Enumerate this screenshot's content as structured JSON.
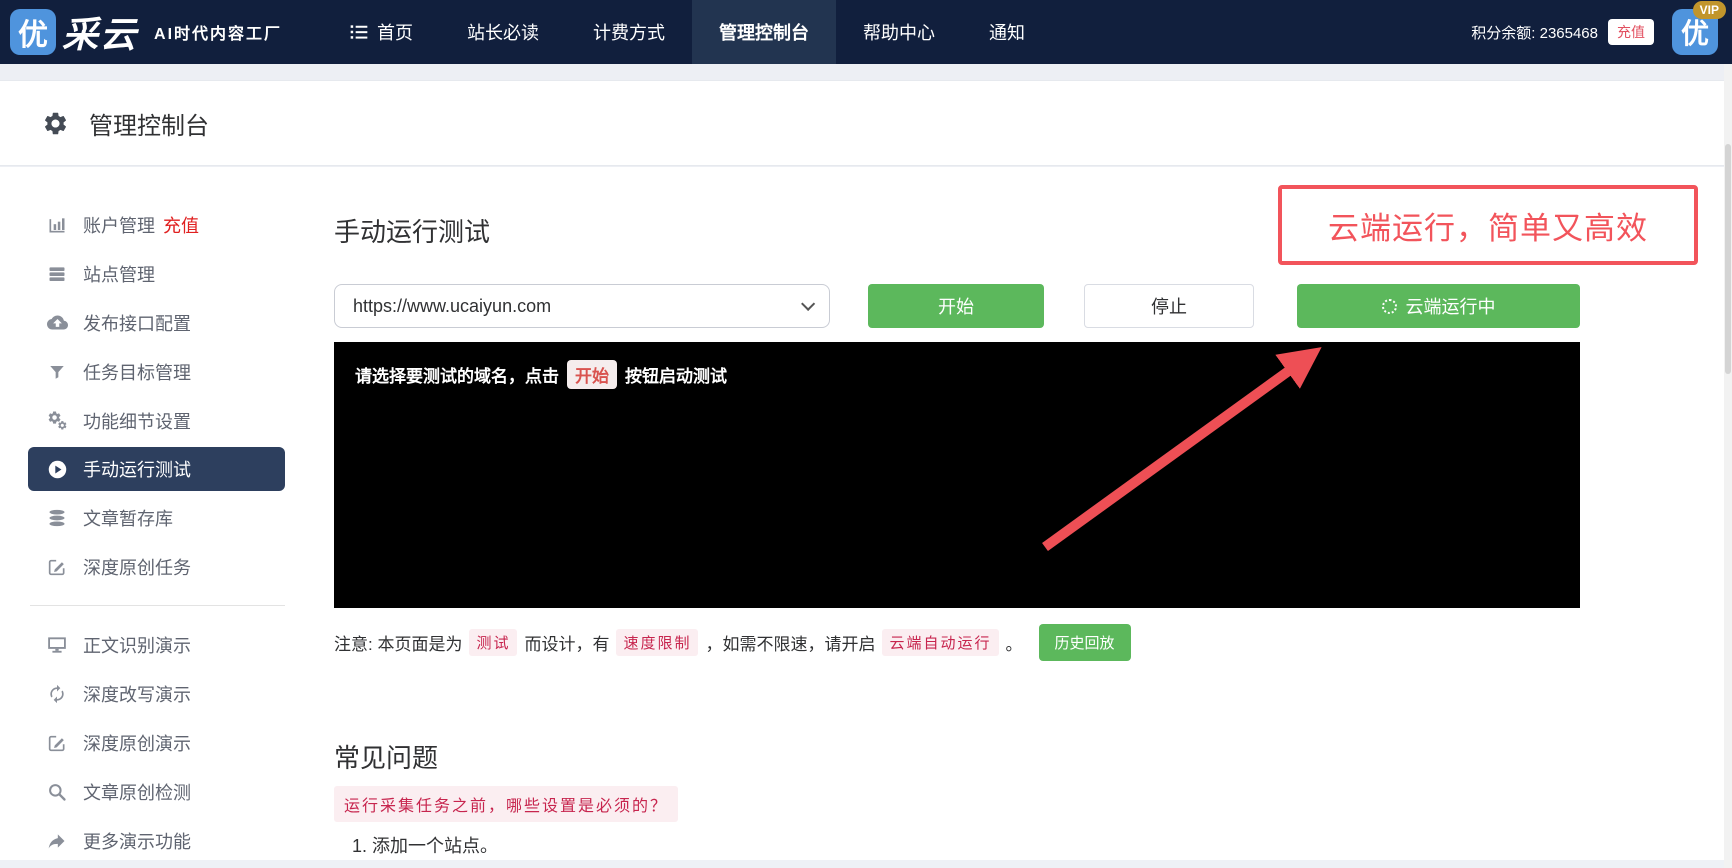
{
  "navbar": {
    "logo_char": "优",
    "logo_rest": "采云",
    "tagline": "AI时代内容工厂",
    "items": [
      {
        "label": "首页",
        "active": false
      },
      {
        "label": "站长必读",
        "active": false
      },
      {
        "label": "计费方式",
        "active": false
      },
      {
        "label": "管理控制台",
        "active": true
      },
      {
        "label": "帮助中心",
        "active": false
      },
      {
        "label": "通知",
        "active": false
      }
    ],
    "points_label": "积分余额: 2365468",
    "recharge_label": "充值",
    "avatar_char": "优",
    "vip_badge": "VIP"
  },
  "page_header": {
    "title": "管理控制台"
  },
  "sidebar": {
    "items": [
      {
        "label": "账户管理",
        "badge": "充值",
        "icon": "bar-chart-icon"
      },
      {
        "label": "站点管理",
        "icon": "server-icon"
      },
      {
        "label": "发布接口配置",
        "icon": "cloud-upload-icon"
      },
      {
        "label": "任务目标管理",
        "icon": "funnel-icon"
      },
      {
        "label": "功能细节设置",
        "icon": "gears-icon"
      },
      {
        "label": "手动运行测试",
        "icon": "play-icon",
        "active": true
      },
      {
        "label": "文章暂存库",
        "icon": "database-icon"
      },
      {
        "label": "深度原创任务",
        "icon": "edit-icon"
      }
    ],
    "items_secondary": [
      {
        "label": "正文识别演示",
        "icon": "monitor-icon"
      },
      {
        "label": "深度改写演示",
        "icon": "sync-icon"
      },
      {
        "label": "深度原创演示",
        "icon": "edit-square-icon"
      },
      {
        "label": "文章原创检测",
        "icon": "search-icon"
      },
      {
        "label": "更多演示功能",
        "icon": "share-arrow-icon"
      }
    ]
  },
  "main": {
    "section_title": "手动运行测试",
    "domain_select": {
      "value": "https://www.ucaiyun.com"
    },
    "start_button": "开始",
    "stop_button": "停止",
    "cloud_button": "云端运行中",
    "annotation": "云端运行，简单又高效",
    "console": {
      "text_before": "请选择要测试的域名，点击",
      "text_code": "开始",
      "text_after": "按钮启动测试"
    },
    "note": {
      "prefix": "注意: 本页面是为",
      "code1": "测试",
      "mid1": "而设计，有",
      "code2": "速度限制",
      "mid2": "，如需不限速，请开启",
      "code3": "云端自动运行",
      "suffix": "。",
      "history_button": "历史回放"
    },
    "faq": {
      "title": "常见问题",
      "question": "运行采集任务之前，哪些设置是必须的？",
      "list_items": [
        "1. 添加一个站点。"
      ]
    }
  },
  "colors": {
    "navbar_bg": "#111f3d",
    "navbar_active_bg": "#223450",
    "brand_blue": "#4f94dd",
    "green": "#5cb85c",
    "annotation_red": "#f2545b",
    "sidebar_active_bg": "#2d3f5e",
    "code_bg": "#fbeef1",
    "code_text": "#c7254e",
    "vip_gold": "#c1952c"
  }
}
